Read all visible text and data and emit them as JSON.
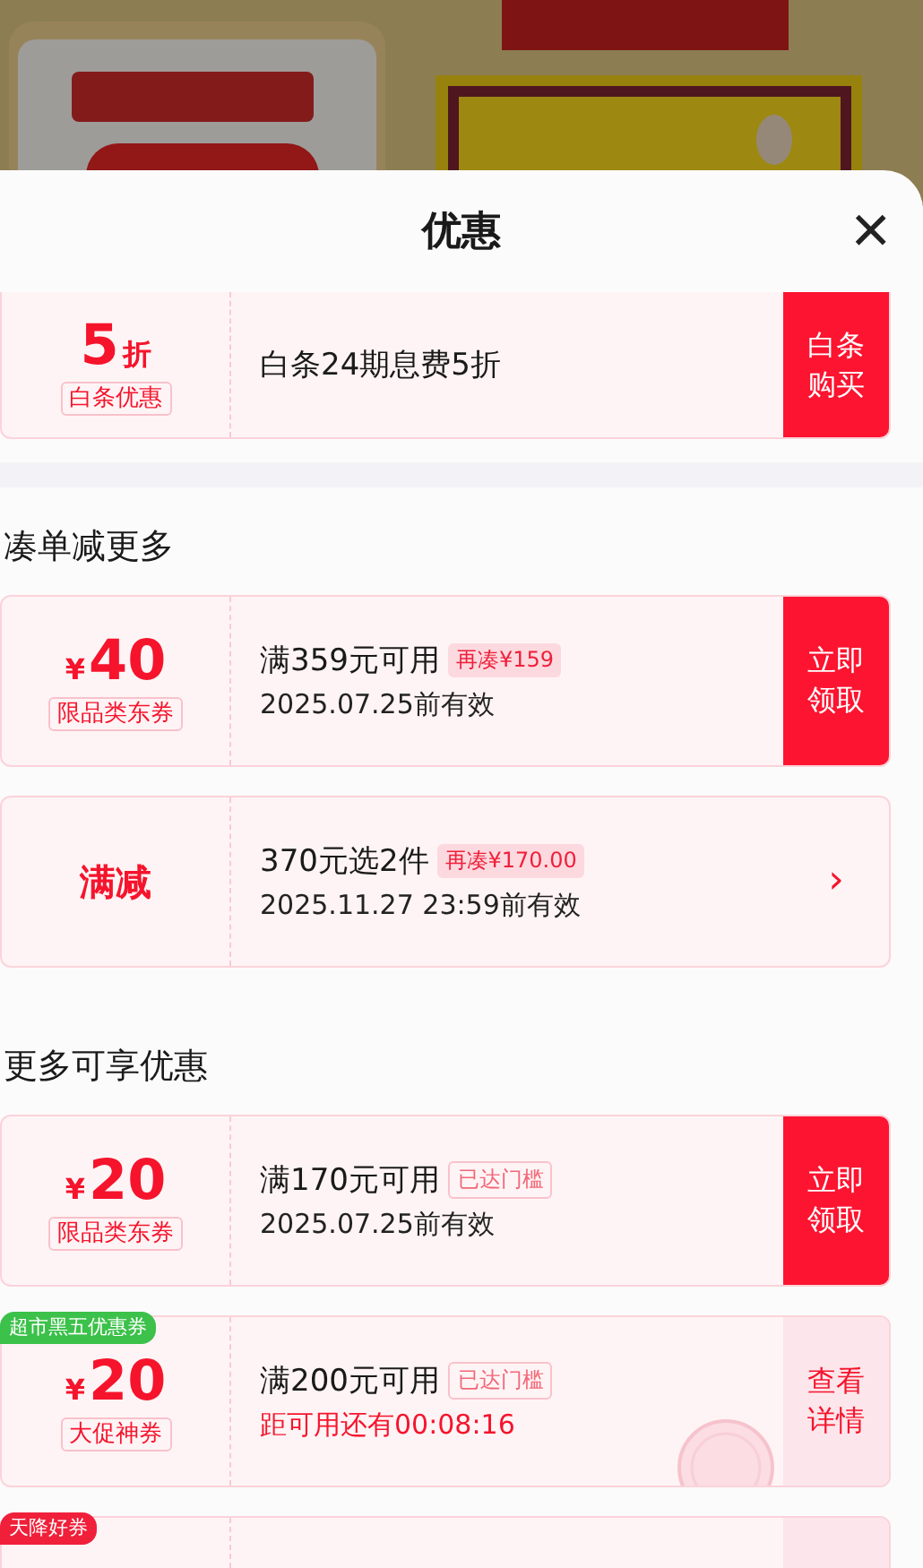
{
  "sheet": {
    "title": "优惠",
    "close": "×"
  },
  "sections": [
    {
      "coupons": [
        {
          "amount": {
            "kind": "discount",
            "value": "5",
            "unit": "折"
          },
          "tag": "白条优惠",
          "title": "白条24期息费5折",
          "action": {
            "kind": "button",
            "text": "白条购买"
          },
          "cut_top": true
        }
      ]
    },
    {
      "title": "凑单减更多",
      "coupons": [
        {
          "amount": {
            "kind": "yuan",
            "currency": "¥",
            "value": "40"
          },
          "tag": "限品类东券",
          "title": "满359元可用",
          "badge": {
            "kind": "add",
            "text": "再凑¥159"
          },
          "subtitle": "2025.07.25前有效",
          "subtitle_alert": false,
          "action": {
            "kind": "button",
            "text": "立即领取"
          }
        },
        {
          "amount": {
            "kind": "label",
            "text": "满减"
          },
          "title": "370元选2件",
          "badge": {
            "kind": "add",
            "text": "再凑¥170.00"
          },
          "subtitle": "2025.11.27 23:59前有效",
          "subtitle_alert": false,
          "action": {
            "kind": "chevron",
            "text": "›"
          }
        }
      ]
    },
    {
      "title": "更多可享优惠",
      "coupons": [
        {
          "amount": {
            "kind": "yuan",
            "currency": "¥",
            "value": "20"
          },
          "tag": "限品类东券",
          "title": "满170元可用",
          "badge": {
            "kind": "reached",
            "text": "已达门槛"
          },
          "subtitle": "2025.07.25前有效",
          "subtitle_alert": false,
          "action": {
            "kind": "button",
            "text": "立即领取"
          }
        },
        {
          "corner": {
            "text": "超市黑五优惠券",
            "color": "#3cc14a"
          },
          "amount": {
            "kind": "yuan",
            "currency": "¥",
            "value": "20"
          },
          "tag": "大促神券",
          "title": "满200元可用",
          "badge": {
            "kind": "reached",
            "text": "已达门槛"
          },
          "subtitle": "距可用还有00:08:16",
          "subtitle_alert": true,
          "stamp": true,
          "action": {
            "kind": "soft",
            "text": "查看详情"
          }
        },
        {
          "corner": {
            "text": "天降好券",
            "color": "#f0203a"
          },
          "cut_bottom": true,
          "action": {
            "kind": "soft"
          }
        }
      ]
    }
  ]
}
